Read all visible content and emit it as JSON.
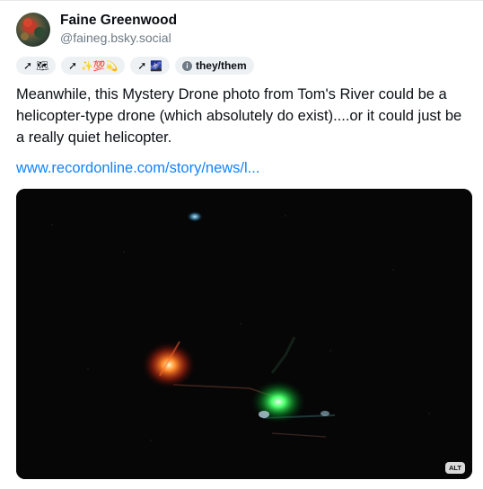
{
  "author": {
    "display_name": "Faine Greenwood",
    "handle": "@faineg.bsky.social"
  },
  "badges": [
    {
      "icon": "swirl",
      "emoji": "🗺"
    },
    {
      "icon": "swirl",
      "emoji": "✨💯💫"
    },
    {
      "icon": "swirl",
      "emoji": "🌌"
    }
  ],
  "pronouns": "they/them",
  "post": {
    "text": "Meanwhile, this Mystery Drone photo from Tom's River could be a helicopter-type drone (which absolutely do exist)....or it could just be a really quiet helicopter.",
    "link": "www.recordonline.com/story/news/l..."
  },
  "media": {
    "alt_label": "ALT"
  }
}
